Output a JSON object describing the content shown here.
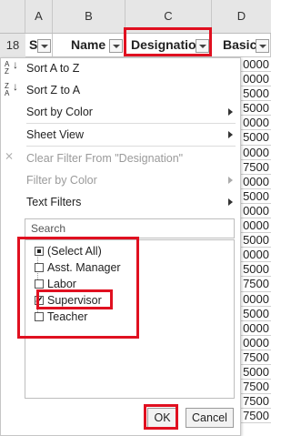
{
  "columns": [
    "A",
    "B",
    "C",
    "D"
  ],
  "row_number": "18",
  "headers": {
    "a": "Sl",
    "b": "Name",
    "c": "Designatio",
    "d": "Basic"
  },
  "data_values": [
    "0000",
    "0000",
    "5000",
    "5000",
    "0000",
    "5000",
    "0000",
    "7500",
    "0000",
    "5000",
    "0000",
    "0000",
    "5000",
    "0000",
    "5000",
    "7500",
    "0000",
    "5000",
    "0000",
    "0000",
    "7500",
    "5000",
    "7500",
    "7500",
    "7500"
  ],
  "menu": {
    "sort_az": "Sort A to Z",
    "sort_za": "Sort Z to A",
    "sort_color": "Sort by Color",
    "sheet_view": "Sheet View",
    "clear_filter": "Clear Filter From \"Designation\"",
    "filter_color": "Filter by Color",
    "text_filters": "Text Filters",
    "search_placeholder": "Search"
  },
  "filter_items": [
    {
      "label": "(Select All)",
      "state": "indeterminate"
    },
    {
      "label": "Asst. Manager",
      "state": "unchecked"
    },
    {
      "label": "Labor",
      "state": "unchecked"
    },
    {
      "label": "Supervisor",
      "state": "checked"
    },
    {
      "label": "Teacher",
      "state": "unchecked"
    }
  ],
  "buttons": {
    "ok": "OK",
    "cancel": "Cancel"
  },
  "highlight_color": "#e01020"
}
